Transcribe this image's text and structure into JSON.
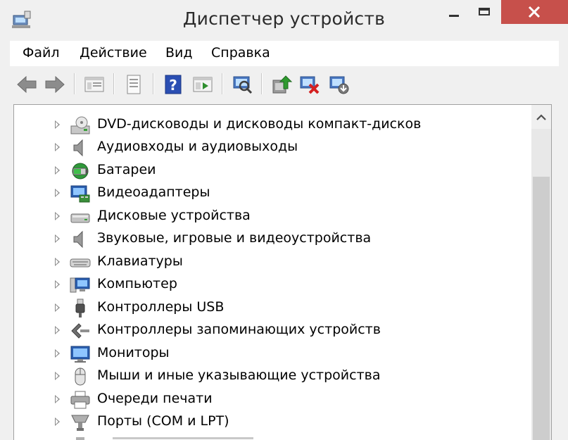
{
  "window": {
    "title": "Диспетчер устройств"
  },
  "menu": {
    "items": [
      "Файл",
      "Действие",
      "Вид",
      "Справка"
    ]
  },
  "toolbar": {
    "buttons": [
      "back-icon",
      "forward-icon",
      "properties-pane-icon",
      "list-view-icon",
      "help-icon",
      "run-icon",
      "scan-hardware-icon",
      "update-driver-icon",
      "uninstall-device-icon",
      "enable-device-icon"
    ]
  },
  "tree": {
    "items": [
      {
        "label": "DVD-дисководы и дисководы компакт-дисков",
        "icon": "dvd-drive-icon"
      },
      {
        "label": "Аудиовходы и аудиовыходы",
        "icon": "speaker-icon"
      },
      {
        "label": "Батареи",
        "icon": "battery-icon"
      },
      {
        "label": "Видеоадаптеры",
        "icon": "display-adapter-icon"
      },
      {
        "label": "Дисковые устройства",
        "icon": "disk-drive-icon"
      },
      {
        "label": "Звуковые, игровые и видеоустройства",
        "icon": "sound-icon"
      },
      {
        "label": "Клавиатуры",
        "icon": "keyboard-icon"
      },
      {
        "label": "Компьютер",
        "icon": "computer-icon"
      },
      {
        "label": "Контроллеры USB",
        "icon": "usb-icon"
      },
      {
        "label": "Контроллеры запоминающих устройств",
        "icon": "storage-controller-icon"
      },
      {
        "label": "Мониторы",
        "icon": "monitor-icon"
      },
      {
        "label": "Мыши и иные указывающие устройства",
        "icon": "mouse-icon"
      },
      {
        "label": "Очереди печати",
        "icon": "printer-icon"
      },
      {
        "label": "Порты (COM и LPT)",
        "icon": "port-icon"
      }
    ]
  },
  "colors": {
    "close_button": "#c7504b",
    "panel_background": "#ffffff",
    "window_background": "#f0f0f0"
  }
}
